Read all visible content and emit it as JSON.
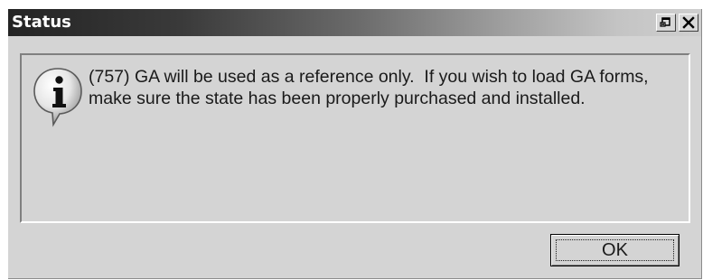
{
  "window": {
    "title": "Status",
    "controls": {
      "restore_icon": "restore-icon",
      "close_icon": "close-icon"
    }
  },
  "message": {
    "icon": "information-icon",
    "text": "(757) GA will be used as a reference only.  If you wish to load GA forms,\nmake sure the state has been properly purchased and installed."
  },
  "buttons": {
    "ok_label": "OK"
  },
  "colors": {
    "dialog_bg": "#d4d4d4",
    "titlebar_dark": "#242424",
    "titlebar_light": "#cfcfcf",
    "title_text": "#ffffff"
  }
}
